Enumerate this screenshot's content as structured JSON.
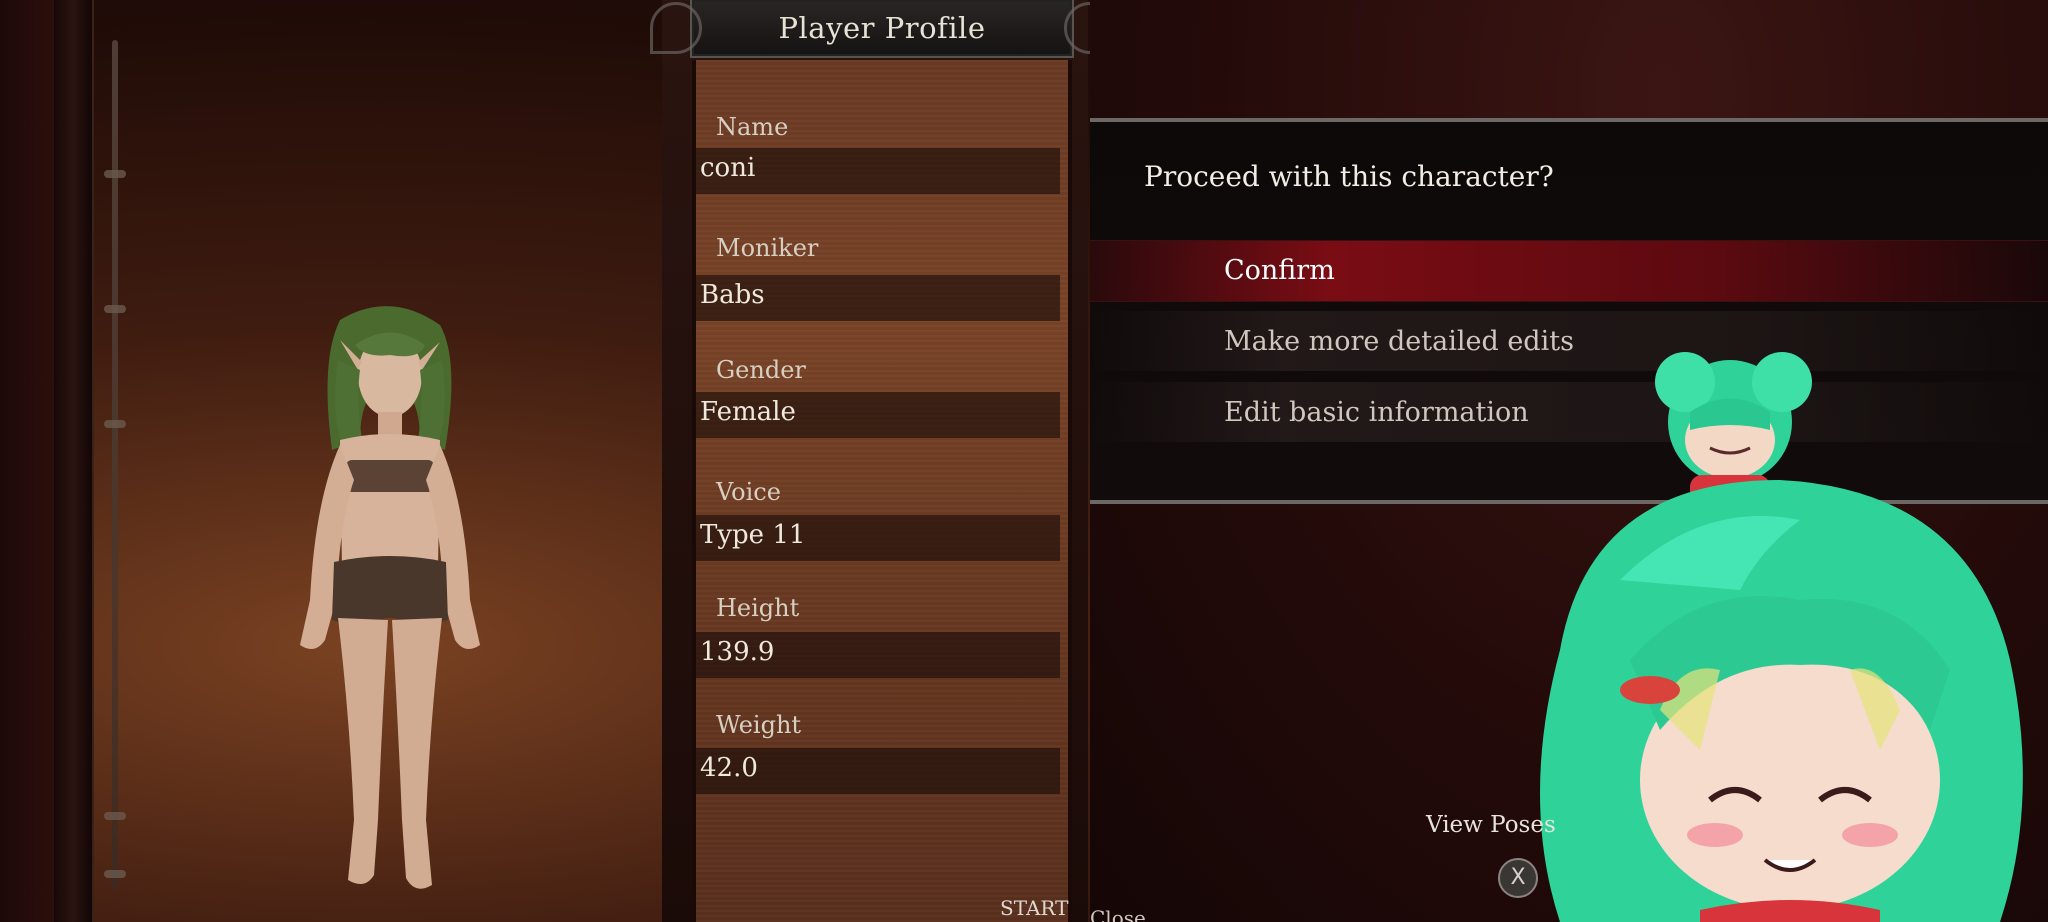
{
  "profile": {
    "title": "Player Profile",
    "fields": [
      {
        "label": "Name",
        "value": "coni"
      },
      {
        "label": "Moniker",
        "value": "Babs"
      },
      {
        "label": "Gender",
        "value": "Female"
      },
      {
        "label": "Voice",
        "value": "Type 11"
      },
      {
        "label": "Height",
        "value": "139.9"
      },
      {
        "label": "Weight",
        "value": "42.0"
      }
    ]
  },
  "dialog": {
    "question": "Proceed with this character?",
    "options": [
      {
        "label": "Confirm",
        "selected": true
      },
      {
        "label": "Make more detailed edits",
        "selected": false
      },
      {
        "label": "Edit basic information",
        "selected": false
      }
    ]
  },
  "hints": {
    "view_poses": "View Poses",
    "x_button": "X",
    "start": "START",
    "close": "Close"
  },
  "colors": {
    "selection": "#7a0c14",
    "panel_brown": "#6a3a24",
    "character_hair": "#4a6a2e",
    "vtuber_hair": "#2fd39a"
  }
}
